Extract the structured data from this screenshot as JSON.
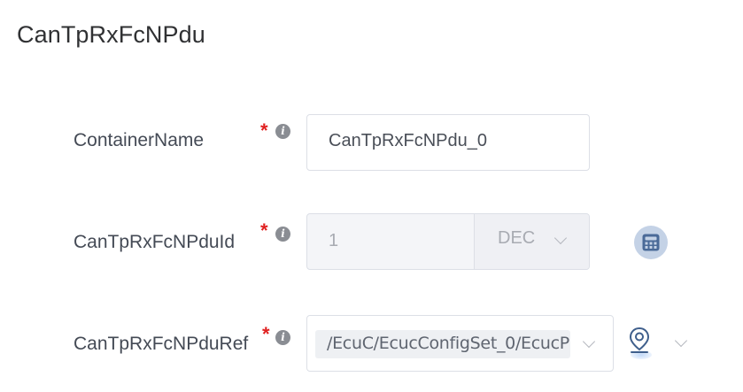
{
  "header": {
    "title": "CanTpRxFcNPdu"
  },
  "fields": {
    "container_name": {
      "label": "ContainerName",
      "required_mark": "*",
      "info_glyph": "i",
      "value": "CanTpRxFcNPdu_0"
    },
    "pdu_id": {
      "label": "CanTpRxFcNPduId",
      "required_mark": "*",
      "info_glyph": "i",
      "value": "1",
      "format": "DEC"
    },
    "pdu_ref": {
      "label": "CanTpRxFcNPduRef",
      "required_mark": "*",
      "info_glyph": "i",
      "value": "/EcuC/EcucConfigSet_0/EcucP"
    }
  },
  "icons": {
    "info": "info-icon",
    "calculator": "calculator-icon",
    "location": "location-pin-icon",
    "chevron": "chevron-down-icon"
  },
  "colors": {
    "required": "#e02020",
    "calculator_bg": "#c4d2e6",
    "calculator_fg": "#3f5f8c",
    "location": "#3f5f8c"
  }
}
